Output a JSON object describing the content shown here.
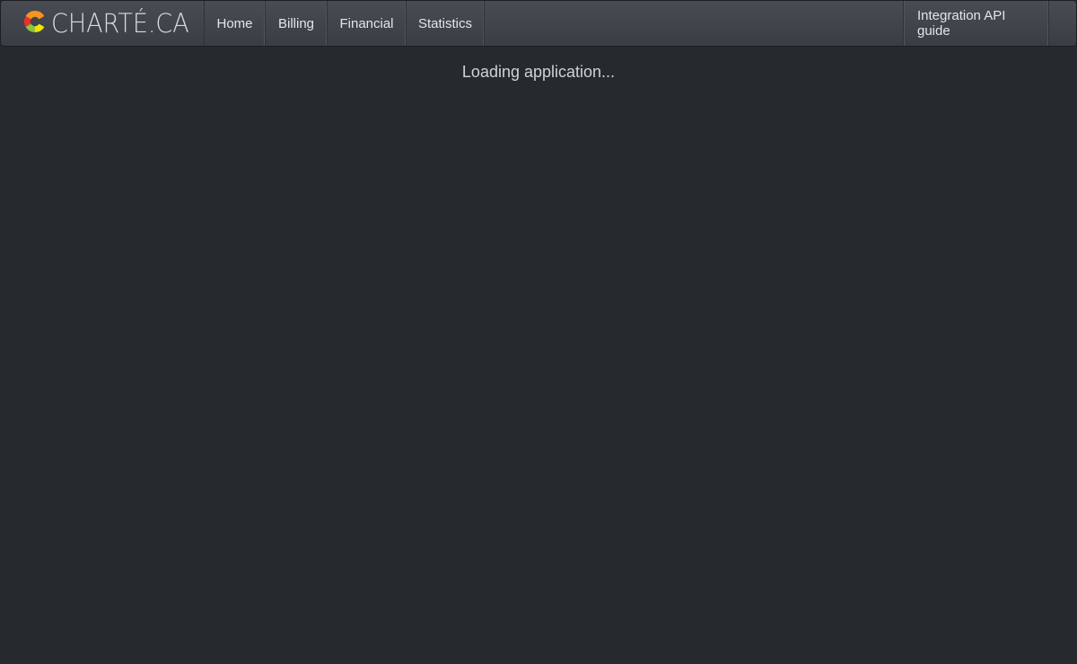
{
  "brand": {
    "name": "CHARTÉ.CA",
    "logo_icon": "charte-c-logo-icon",
    "logo_colors": [
      "#f7941d",
      "#e8312a",
      "#8dc63f",
      "#f2e500"
    ]
  },
  "nav": {
    "items": [
      {
        "label": "Home"
      },
      {
        "label": "Billing"
      },
      {
        "label": "Financial"
      },
      {
        "label": "Statistics"
      }
    ],
    "right_items": [
      {
        "label": "Integration API guide"
      }
    ]
  },
  "main": {
    "loading_text": "Loading application..."
  },
  "colors": {
    "background": "#26292e",
    "navbar": "#3f434a",
    "text": "#e4e6e8"
  }
}
